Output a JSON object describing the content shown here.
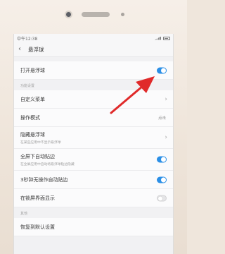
{
  "status": {
    "time": "中午12:38"
  },
  "header": {
    "title": "悬浮球"
  },
  "main_toggle": {
    "label": "打开悬浮球",
    "on": true
  },
  "sections": {
    "function_header": "功能设置",
    "other_header": "其他"
  },
  "items": {
    "custom_menu": {
      "label": "自定义菜单"
    },
    "operation_mode": {
      "label": "操作模式",
      "value": "点击"
    },
    "hide_ball": {
      "label": "隐藏悬浮球",
      "sub": "在某些应用中不显示悬浮球"
    },
    "fullscreen_snap": {
      "label": "全屏下自动贴边",
      "sub": "在全屏应用中自动将悬浮球贴边隐藏",
      "on": true
    },
    "idle_snap": {
      "label": "3秒钟无操作自动贴边",
      "on": true
    },
    "lockscreen": {
      "label": "在锁屏界面显示",
      "on": false
    },
    "reset": {
      "label": "恢复到默认设置"
    }
  },
  "colors": {
    "accent": "#2b8fe6",
    "annotation_arrow": "#e02a2a"
  }
}
